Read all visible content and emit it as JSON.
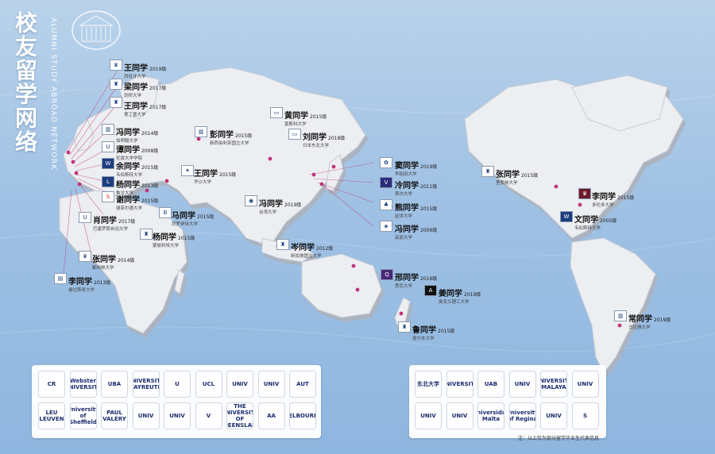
{
  "title": "校友留学网络",
  "subtitle": "ALUMNI STUDY ABROAD NETWORK",
  "colors": {
    "sea": "#9fc1e4",
    "land": "#ebedf0",
    "land_side": "#b9c0c9",
    "accent": "#6b2d7f",
    "pin": "#c0357a"
  },
  "labels": [
    {
      "name": "王同学",
      "year": "2019级",
      "univ": "西班牙大学"
    },
    {
      "name": "梁同学",
      "year": "2017级",
      "univ": "剑桥大学"
    },
    {
      "name": "王同学",
      "year": "2017级",
      "univ": "爱丁堡大学"
    },
    {
      "name": "冯同学",
      "year": "2014级",
      "univ": "伯明翰大学"
    },
    {
      "name": "谭同学",
      "year": "2008级",
      "univ": "伦敦大学学院"
    },
    {
      "name": "余同学",
      "year": "2015级",
      "univ": "韦伯斯特大学"
    },
    {
      "name": "杨同学",
      "year": "2013级",
      "univ": "鲁汶大学"
    },
    {
      "name": "谢同学",
      "year": "2015级",
      "univ": "谢菲尔德大学"
    },
    {
      "name": "肖同学",
      "year": "2017级",
      "univ": "巴塞罗那自治大学"
    },
    {
      "name": "马同学",
      "year": "2015级",
      "univ": "拜罗伊特大学"
    },
    {
      "name": "杨同学",
      "year": "2015级",
      "univ": "蒙彼利埃大学"
    },
    {
      "name": "张同学",
      "year": "2014级",
      "univ": "都柏林大学"
    },
    {
      "name": "李同学",
      "year": "2013级",
      "univ": "格拉斯哥大学"
    },
    {
      "name": "彭同学",
      "year": "2015级",
      "univ": "新西伯利亚国立大学"
    },
    {
      "name": "黄同学",
      "year": "2015级",
      "univ": "莫斯科大学"
    },
    {
      "name": "刘同学",
      "year": "2018级",
      "univ": "日本东北大学"
    },
    {
      "name": "王同学",
      "year": "2015级",
      "univ": "华沙大学"
    },
    {
      "name": "冯同学",
      "year": "2019级",
      "univ": "台湾大学"
    },
    {
      "name": "岑同学",
      "year": "2012级",
      "univ": "新加坡国立大学"
    },
    {
      "name": "窦同学",
      "year": "2019级",
      "univ": "早稻田大学"
    },
    {
      "name": "冷同学",
      "year": "2011级",
      "univ": "首尔大学"
    },
    {
      "name": "熊同学",
      "year": "2015级",
      "univ": "延世大学"
    },
    {
      "name": "冯同学",
      "year": "2006级",
      "univ": "高丽大学"
    },
    {
      "name": "张同学",
      "year": "2015级",
      "univ": "里贾纳大学"
    },
    {
      "name": "李同学",
      "year": "2015级",
      "univ": "多伦多大学"
    },
    {
      "name": "文同学",
      "year": "2005级",
      "univ": "韦伯斯特大学"
    },
    {
      "name": "邢同学",
      "year": "2018级",
      "univ": "悉尼大学"
    },
    {
      "name": "姜同学",
      "year": "2019级",
      "univ": "奥克兰理工大学"
    },
    {
      "name": "鲁同学",
      "year": "2015级",
      "univ": "墨尔本大学"
    },
    {
      "name": "常同学",
      "year": "2019级",
      "univ": "马拉雅大学"
    }
  ],
  "logos_left": [
    "CR",
    "Webster UNIVERSITY",
    "UBA",
    "UNIVERSITY BAYREUTH",
    "U",
    "UCL",
    "UNIV",
    "UNIV",
    "AUT",
    "LEU LEUVEN",
    "University of Sheffield",
    "PAUL VALÉRY",
    "UNIV",
    "UNIV",
    "V",
    "THE UNIVERSITY OF QUEENSLAND",
    "AA",
    "MELBOURNE"
  ],
  "logos_right": [
    "东北大学",
    "UNIVERSITY",
    "UAB",
    "UNIV",
    "UNIVERSITY MALAYA",
    "UNIV",
    "UNIV",
    "UNIV",
    "Universidad Malta",
    "University of Regina",
    "UNIV",
    "S"
  ],
  "note": "注：以上仅为部分留学毕业生代表信息"
}
